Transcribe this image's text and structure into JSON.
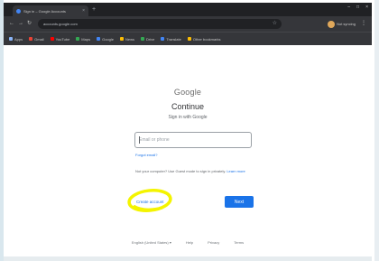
{
  "browser": {
    "tab_title": "Sign in – Google Accounts",
    "tab_close": "×",
    "new_tab": "+",
    "window_controls": {
      "minimize": "–",
      "maximize": "□",
      "close": "×"
    },
    "nav": {
      "back": "←",
      "forward": "→",
      "reload": "↻"
    },
    "address": "accounts.google.com",
    "bookmark_star": "☆",
    "toolbar_extension": "⋮",
    "profile_label": "Not syncing",
    "bookmarks": [
      {
        "label": "Apps",
        "color": "#8ab4f8"
      },
      {
        "label": "Gmail",
        "color": "#ea4335"
      },
      {
        "label": "YouTube",
        "color": "#ff0000"
      },
      {
        "label": "Maps",
        "color": "#34a853"
      },
      {
        "label": "Google",
        "color": "#4285f4"
      },
      {
        "label": "News",
        "color": "#fbbc04"
      },
      {
        "label": "Drive",
        "color": "#34a853"
      },
      {
        "label": "Translate",
        "color": "#4285f4"
      },
      {
        "label": "Other bookmarks",
        "color": "#fbbc04"
      }
    ]
  },
  "signin": {
    "logo": "Google",
    "heading": "Continue",
    "subheading": "Sign in with Google",
    "email_placeholder": "Email or phone",
    "forgot_email": "Forgot email?",
    "guest_text": "Not your computer? Use Guest mode to sign in privately.",
    "guest_link": "Learn more",
    "create_account": "Create account",
    "next": "Next"
  },
  "footer": {
    "language": "English (United States) ▾",
    "help": "Help",
    "privacy": "Privacy",
    "terms": "Terms"
  },
  "colors": {
    "accent": "#1a73e8",
    "highlight": "#f4f400",
    "chrome_dark": "#202124"
  }
}
